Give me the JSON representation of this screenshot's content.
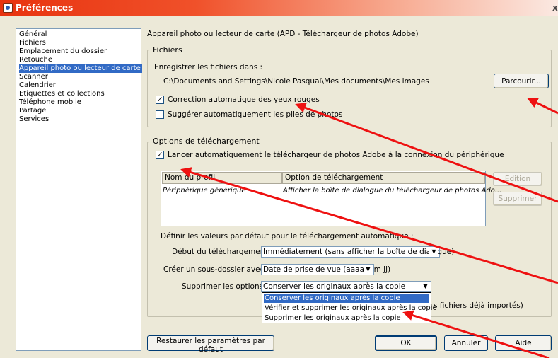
{
  "window": {
    "title": "Préférences",
    "close_glyph": "x"
  },
  "sidebar": {
    "items": [
      {
        "label": "Général"
      },
      {
        "label": "Fichiers"
      },
      {
        "label": "Emplacement du dossier"
      },
      {
        "label": "Retouche"
      },
      {
        "label": "Appareil photo ou lecteur de carte",
        "selected": true
      },
      {
        "label": "Scanner"
      },
      {
        "label": "Calendrier"
      },
      {
        "label": "Etiquettes et collections"
      },
      {
        "label": "Téléphone mobile"
      },
      {
        "label": "Partage"
      },
      {
        "label": "Services"
      }
    ]
  },
  "panel": {
    "title": "Appareil photo ou lecteur de carte (APD - Téléchargeur de photos Adobe)"
  },
  "files_group": {
    "legend": "Fichiers",
    "save_label": "Enregistrer les fichiers dans :",
    "path": "C:\\Documents and Settings\\Nicole Pasqual\\Mes documents\\Mes images",
    "browse_button": "Parcourir...",
    "red_eye": {
      "label": "Correction automatique des yeux rouges",
      "checked": true
    },
    "suggest_stacks": {
      "label": "Suggérer automatiquement les piles de photos",
      "checked": false
    }
  },
  "download_group": {
    "legend": "Options de téléchargement",
    "auto_launch": {
      "label": "Lancer automatiquement le téléchargeur de photos Adobe à la connexion du périphérique",
      "checked": true
    },
    "table": {
      "columns": [
        "Nom du profil",
        "Option de téléchargement"
      ],
      "rows": [
        {
          "profile": "Périphérique générique",
          "option": "Afficher la boîte de dialogue du téléchargeur de photos Ado..."
        }
      ]
    },
    "edit_button": "Edition",
    "delete_button": "Supprimer",
    "defaults_label": "Définir les valeurs par défaut pour le téléchargement automatique :",
    "start_download": {
      "label": "Début du téléchargement :",
      "value": "Immédiatement (sans afficher la boîte de dialogue)"
    },
    "subfolder": {
      "label": "Créer un sous-dossier avec :",
      "value": "Date de prise de vue (aaaa mm jj)"
    },
    "delete_options": {
      "label": "Supprimer les options :",
      "value": "Conserver les originaux après la copie",
      "options": [
        "Conserver les originaux après la copie",
        "Vérifier et supprimer les originaux après la copie",
        "Supprimer les originaux après la copie"
      ]
    },
    "partial_text": "s fichiers déjà importés)"
  },
  "footer": {
    "restore_button": "Restaurer les paramètres par défaut",
    "ok_button": "OK",
    "cancel_button": "Annuler",
    "help_button": "Aide"
  },
  "colors": {
    "titlebar": "#e8330f",
    "selection": "#316ac5",
    "annotation_arrow": "#ee1111"
  }
}
